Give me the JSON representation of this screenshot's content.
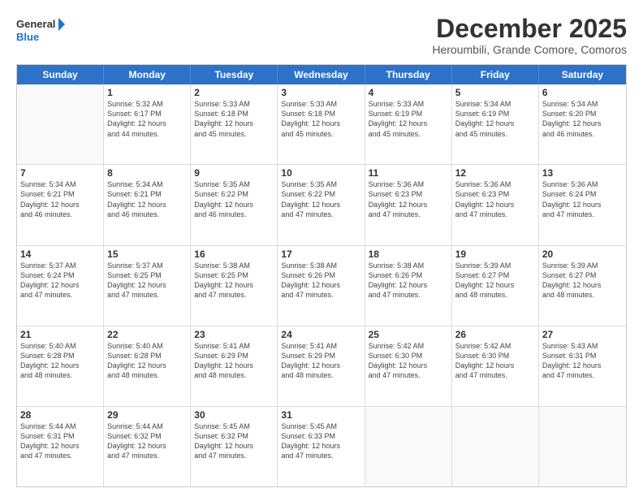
{
  "header": {
    "logo_line1": "General",
    "logo_line2": "Blue",
    "month": "December 2025",
    "location": "Heroumbili, Grande Comore, Comoros"
  },
  "weekdays": [
    "Sunday",
    "Monday",
    "Tuesday",
    "Wednesday",
    "Thursday",
    "Friday",
    "Saturday"
  ],
  "rows": [
    [
      {
        "day": "",
        "info": ""
      },
      {
        "day": "1",
        "info": "Sunrise: 5:32 AM\nSunset: 6:17 PM\nDaylight: 12 hours\nand 44 minutes."
      },
      {
        "day": "2",
        "info": "Sunrise: 5:33 AM\nSunset: 6:18 PM\nDaylight: 12 hours\nand 45 minutes."
      },
      {
        "day": "3",
        "info": "Sunrise: 5:33 AM\nSunset: 6:18 PM\nDaylight: 12 hours\nand 45 minutes."
      },
      {
        "day": "4",
        "info": "Sunrise: 5:33 AM\nSunset: 6:19 PM\nDaylight: 12 hours\nand 45 minutes."
      },
      {
        "day": "5",
        "info": "Sunrise: 5:34 AM\nSunset: 6:19 PM\nDaylight: 12 hours\nand 45 minutes."
      },
      {
        "day": "6",
        "info": "Sunrise: 5:34 AM\nSunset: 6:20 PM\nDaylight: 12 hours\nand 46 minutes."
      }
    ],
    [
      {
        "day": "7",
        "info": "Sunrise: 5:34 AM\nSunset: 6:21 PM\nDaylight: 12 hours\nand 46 minutes."
      },
      {
        "day": "8",
        "info": "Sunrise: 5:34 AM\nSunset: 6:21 PM\nDaylight: 12 hours\nand 46 minutes."
      },
      {
        "day": "9",
        "info": "Sunrise: 5:35 AM\nSunset: 6:22 PM\nDaylight: 12 hours\nand 46 minutes."
      },
      {
        "day": "10",
        "info": "Sunrise: 5:35 AM\nSunset: 6:22 PM\nDaylight: 12 hours\nand 47 minutes."
      },
      {
        "day": "11",
        "info": "Sunrise: 5:36 AM\nSunset: 6:23 PM\nDaylight: 12 hours\nand 47 minutes."
      },
      {
        "day": "12",
        "info": "Sunrise: 5:36 AM\nSunset: 6:23 PM\nDaylight: 12 hours\nand 47 minutes."
      },
      {
        "day": "13",
        "info": "Sunrise: 5:36 AM\nSunset: 6:24 PM\nDaylight: 12 hours\nand 47 minutes."
      }
    ],
    [
      {
        "day": "14",
        "info": "Sunrise: 5:37 AM\nSunset: 6:24 PM\nDaylight: 12 hours\nand 47 minutes."
      },
      {
        "day": "15",
        "info": "Sunrise: 5:37 AM\nSunset: 6:25 PM\nDaylight: 12 hours\nand 47 minutes."
      },
      {
        "day": "16",
        "info": "Sunrise: 5:38 AM\nSunset: 6:25 PM\nDaylight: 12 hours\nand 47 minutes."
      },
      {
        "day": "17",
        "info": "Sunrise: 5:38 AM\nSunset: 6:26 PM\nDaylight: 12 hours\nand 47 minutes."
      },
      {
        "day": "18",
        "info": "Sunrise: 5:38 AM\nSunset: 6:26 PM\nDaylight: 12 hours\nand 47 minutes."
      },
      {
        "day": "19",
        "info": "Sunrise: 5:39 AM\nSunset: 6:27 PM\nDaylight: 12 hours\nand 48 minutes."
      },
      {
        "day": "20",
        "info": "Sunrise: 5:39 AM\nSunset: 6:27 PM\nDaylight: 12 hours\nand 48 minutes."
      }
    ],
    [
      {
        "day": "21",
        "info": "Sunrise: 5:40 AM\nSunset: 6:28 PM\nDaylight: 12 hours\nand 48 minutes."
      },
      {
        "day": "22",
        "info": "Sunrise: 5:40 AM\nSunset: 6:28 PM\nDaylight: 12 hours\nand 48 minutes."
      },
      {
        "day": "23",
        "info": "Sunrise: 5:41 AM\nSunset: 6:29 PM\nDaylight: 12 hours\nand 48 minutes."
      },
      {
        "day": "24",
        "info": "Sunrise: 5:41 AM\nSunset: 6:29 PM\nDaylight: 12 hours\nand 48 minutes."
      },
      {
        "day": "25",
        "info": "Sunrise: 5:42 AM\nSunset: 6:30 PM\nDaylight: 12 hours\nand 47 minutes."
      },
      {
        "day": "26",
        "info": "Sunrise: 5:42 AM\nSunset: 6:30 PM\nDaylight: 12 hours\nand 47 minutes."
      },
      {
        "day": "27",
        "info": "Sunrise: 5:43 AM\nSunset: 6:31 PM\nDaylight: 12 hours\nand 47 minutes."
      }
    ],
    [
      {
        "day": "28",
        "info": "Sunrise: 5:44 AM\nSunset: 6:31 PM\nDaylight: 12 hours\nand 47 minutes."
      },
      {
        "day": "29",
        "info": "Sunrise: 5:44 AM\nSunset: 6:32 PM\nDaylight: 12 hours\nand 47 minutes."
      },
      {
        "day": "30",
        "info": "Sunrise: 5:45 AM\nSunset: 6:32 PM\nDaylight: 12 hours\nand 47 minutes."
      },
      {
        "day": "31",
        "info": "Sunrise: 5:45 AM\nSunset: 6:33 PM\nDaylight: 12 hours\nand 47 minutes."
      },
      {
        "day": "",
        "info": ""
      },
      {
        "day": "",
        "info": ""
      },
      {
        "day": "",
        "info": ""
      }
    ]
  ]
}
